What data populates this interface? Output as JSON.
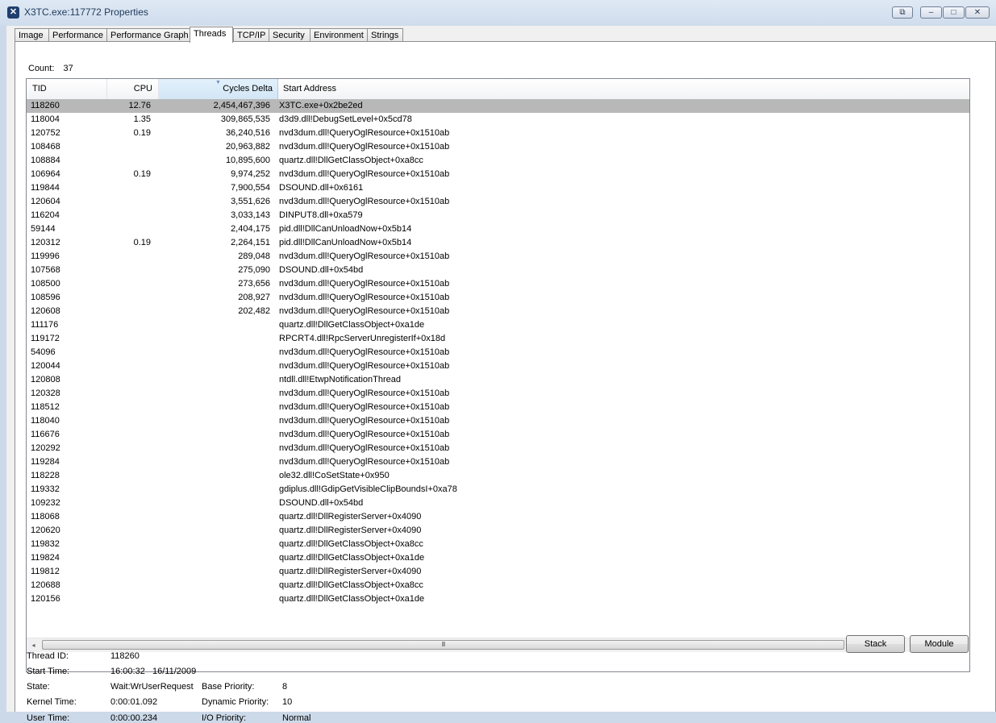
{
  "window": {
    "title": "X3TC.exe:117772 Properties",
    "buttons": {
      "extra": "⧉",
      "minimize": "–",
      "maximize": "□",
      "close": "✕"
    }
  },
  "tabs": [
    "Image",
    "Performance",
    "Performance Graph",
    "Threads",
    "TCP/IP",
    "Security",
    "Environment",
    "Strings"
  ],
  "active_tab": "Threads",
  "count": {
    "label": "Count:",
    "value": "37"
  },
  "columns": {
    "tid": "TID",
    "cpu": "CPU",
    "cycles": "Cycles Delta",
    "address": "Start Address"
  },
  "sorted_column": "Cycles Delta",
  "threads": [
    {
      "tid": "118260",
      "cpu": "12.76",
      "cycles": "2,454,467,396",
      "address": "X3TC.exe+0x2be2ed"
    },
    {
      "tid": "118004",
      "cpu": "1.35",
      "cycles": "309,865,535",
      "address": "d3d9.dll!DebugSetLevel+0x5cd78"
    },
    {
      "tid": "120752",
      "cpu": "0.19",
      "cycles": "36,240,516",
      "address": "nvd3dum.dll!QueryOglResource+0x1510ab"
    },
    {
      "tid": "108468",
      "cpu": "",
      "cycles": "20,963,882",
      "address": "nvd3dum.dll!QueryOglResource+0x1510ab"
    },
    {
      "tid": "108884",
      "cpu": "",
      "cycles": "10,895,600",
      "address": "quartz.dll!DllGetClassObject+0xa8cc"
    },
    {
      "tid": "106964",
      "cpu": "0.19",
      "cycles": "9,974,252",
      "address": "nvd3dum.dll!QueryOglResource+0x1510ab"
    },
    {
      "tid": "119844",
      "cpu": "",
      "cycles": "7,900,554",
      "address": "DSOUND.dll+0x6161"
    },
    {
      "tid": "120604",
      "cpu": "",
      "cycles": "3,551,626",
      "address": "nvd3dum.dll!QueryOglResource+0x1510ab"
    },
    {
      "tid": "116204",
      "cpu": "",
      "cycles": "3,033,143",
      "address": "DINPUT8.dll+0xa579"
    },
    {
      "tid": "59144",
      "cpu": "",
      "cycles": "2,404,175",
      "address": "pid.dll!DllCanUnloadNow+0x5b14"
    },
    {
      "tid": "120312",
      "cpu": "0.19",
      "cycles": "2,264,151",
      "address": "pid.dll!DllCanUnloadNow+0x5b14"
    },
    {
      "tid": "119996",
      "cpu": "",
      "cycles": "289,048",
      "address": "nvd3dum.dll!QueryOglResource+0x1510ab"
    },
    {
      "tid": "107568",
      "cpu": "",
      "cycles": "275,090",
      "address": "DSOUND.dll+0x54bd"
    },
    {
      "tid": "108500",
      "cpu": "",
      "cycles": "273,656",
      "address": "nvd3dum.dll!QueryOglResource+0x1510ab"
    },
    {
      "tid": "108596",
      "cpu": "",
      "cycles": "208,927",
      "address": "nvd3dum.dll!QueryOglResource+0x1510ab"
    },
    {
      "tid": "120608",
      "cpu": "",
      "cycles": "202,482",
      "address": "nvd3dum.dll!QueryOglResource+0x1510ab"
    },
    {
      "tid": "111176",
      "cpu": "",
      "cycles": "",
      "address": "quartz.dll!DllGetClassObject+0xa1de"
    },
    {
      "tid": "119172",
      "cpu": "",
      "cycles": "",
      "address": "RPCRT4.dll!RpcServerUnregisterIf+0x18d"
    },
    {
      "tid": "54096",
      "cpu": "",
      "cycles": "",
      "address": "nvd3dum.dll!QueryOglResource+0x1510ab"
    },
    {
      "tid": "120044",
      "cpu": "",
      "cycles": "",
      "address": "nvd3dum.dll!QueryOglResource+0x1510ab"
    },
    {
      "tid": "120808",
      "cpu": "",
      "cycles": "",
      "address": "ntdll.dll!EtwpNotificationThread"
    },
    {
      "tid": "120328",
      "cpu": "",
      "cycles": "",
      "address": "nvd3dum.dll!QueryOglResource+0x1510ab"
    },
    {
      "tid": "118512",
      "cpu": "",
      "cycles": "",
      "address": "nvd3dum.dll!QueryOglResource+0x1510ab"
    },
    {
      "tid": "118040",
      "cpu": "",
      "cycles": "",
      "address": "nvd3dum.dll!QueryOglResource+0x1510ab"
    },
    {
      "tid": "116676",
      "cpu": "",
      "cycles": "",
      "address": "nvd3dum.dll!QueryOglResource+0x1510ab"
    },
    {
      "tid": "120292",
      "cpu": "",
      "cycles": "",
      "address": "nvd3dum.dll!QueryOglResource+0x1510ab"
    },
    {
      "tid": "119284",
      "cpu": "",
      "cycles": "",
      "address": "nvd3dum.dll!QueryOglResource+0x1510ab"
    },
    {
      "tid": "118228",
      "cpu": "",
      "cycles": "",
      "address": "ole32.dll!CoSetState+0x950"
    },
    {
      "tid": "119332",
      "cpu": "",
      "cycles": "",
      "address": "gdiplus.dll!GdipGetVisibleClipBoundsI+0xa78"
    },
    {
      "tid": "109232",
      "cpu": "",
      "cycles": "",
      "address": "DSOUND.dll+0x54bd"
    },
    {
      "tid": "118068",
      "cpu": "",
      "cycles": "",
      "address": "quartz.dll!DllRegisterServer+0x4090"
    },
    {
      "tid": "120620",
      "cpu": "",
      "cycles": "",
      "address": "quartz.dll!DllRegisterServer+0x4090"
    },
    {
      "tid": "119832",
      "cpu": "",
      "cycles": "",
      "address": "quartz.dll!DllGetClassObject+0xa8cc"
    },
    {
      "tid": "119824",
      "cpu": "",
      "cycles": "",
      "address": "quartz.dll!DllGetClassObject+0xa1de"
    },
    {
      "tid": "119812",
      "cpu": "",
      "cycles": "",
      "address": "quartz.dll!DllRegisterServer+0x4090"
    },
    {
      "tid": "120688",
      "cpu": "",
      "cycles": "",
      "address": "quartz.dll!DllGetClassObject+0xa8cc"
    },
    {
      "tid": "120156",
      "cpu": "",
      "cycles": "",
      "address": "quartz.dll!DllGetClassObject+0xa1de"
    }
  ],
  "selected_tid": "118260",
  "scrollbar": {
    "left_arrow": "◂",
    "right_arrow": "▸",
    "grip": "III"
  },
  "buttons": {
    "stack": "Stack",
    "module": "Module"
  },
  "details": {
    "thread_id": {
      "label": "Thread ID:",
      "value": "118260"
    },
    "start_time": {
      "label": "Start Time:",
      "value": "16:00:32   16/11/2009"
    },
    "state": {
      "label": "State:",
      "value": "Wait:WrUserRequest"
    },
    "base_priority": {
      "label": "Base Priority:",
      "value": "8"
    },
    "kernel_time": {
      "label": "Kernel Time:",
      "value": "0:00:01.092"
    },
    "dynamic_priority": {
      "label": "Dynamic Priority:",
      "value": "10"
    },
    "user_time": {
      "label": "User Time:",
      "value": "0:00:00.234"
    },
    "io_priority": {
      "label": "I/O Priority:",
      "value": "Normal"
    }
  }
}
